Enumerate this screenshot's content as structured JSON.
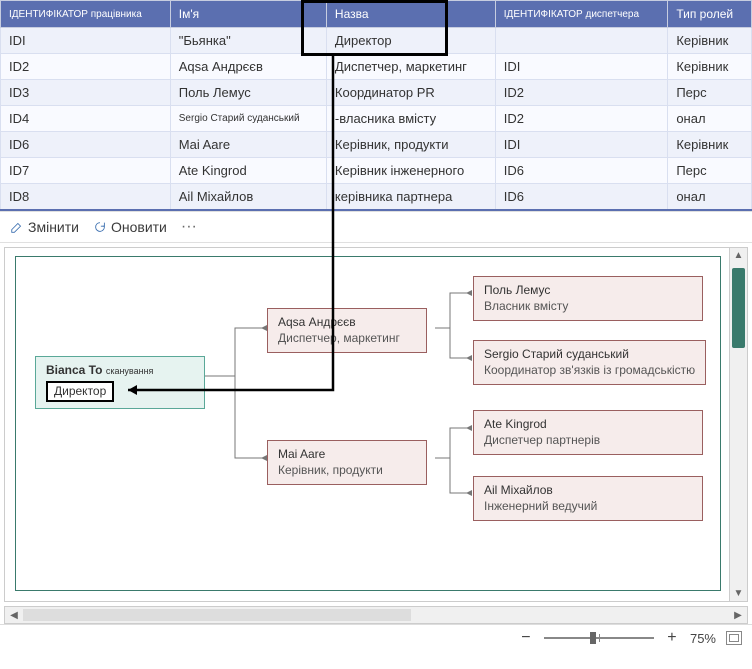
{
  "table": {
    "headers": [
      "ІДЕНТИФІКАТОР працівника",
      "Ім'я",
      "Назва",
      "ІДЕНТИФІКАТОР диспетчера",
      "Тип ролей"
    ],
    "rows": [
      {
        "id": "IDI",
        "name": "\"Бьянка\"",
        "title": "Директор",
        "manager": "",
        "role": "Керівник"
      },
      {
        "id": "ID2",
        "name": "Aqsa Андрєєв",
        "title": "Диспетчер, маркетинг",
        "manager": "IDI",
        "role": "Керівник"
      },
      {
        "id": "ID3",
        "name": "Поль Лемус",
        "title": "Координатор PR",
        "manager": "ID2",
        "role": "Перс"
      },
      {
        "id": "ID4",
        "name": "Sergio Старий суданський",
        "title": "-власника вмісту",
        "manager": "ID2",
        "role": "онал"
      },
      {
        "id": "ID6",
        "name": "Mai Aare",
        "title": "Керівник, продукти",
        "manager": "IDI",
        "role": "Керівник"
      },
      {
        "id": "ID7",
        "name": "Ate Kingrod",
        "title": "Керівник інженерного",
        "manager": "ID6",
        "role": "Перс"
      },
      {
        "id": "ID8",
        "name": "Ail Міхайлов",
        "title": "керівника партнера",
        "manager": "ID6",
        "role": "онал"
      }
    ]
  },
  "toolbar": {
    "edit": "Змінити",
    "refresh": "Оновити",
    "more": "···"
  },
  "org": {
    "root": {
      "name": "Bianca To",
      "suffix": "сканування",
      "title": "Директор"
    },
    "level2": [
      {
        "name": "Aqsa Андрєєв",
        "title": "Диспетчер, маркетинг"
      },
      {
        "name": "Mai Aare",
        "title": "Керівник, продукти"
      }
    ],
    "level3": [
      {
        "name": "Поль Лемус",
        "title": "Власник вмісту"
      },
      {
        "name": "Sergio Старий суданський",
        "title": "Координатор зв'язків із громадськістю"
      },
      {
        "name": "Ate Kingrod",
        "title": "Диспетчер партнерів"
      },
      {
        "name": "Ail Міхайлов",
        "title": "Інженерний ведучий"
      }
    ]
  },
  "status": {
    "zoom": "75%"
  }
}
